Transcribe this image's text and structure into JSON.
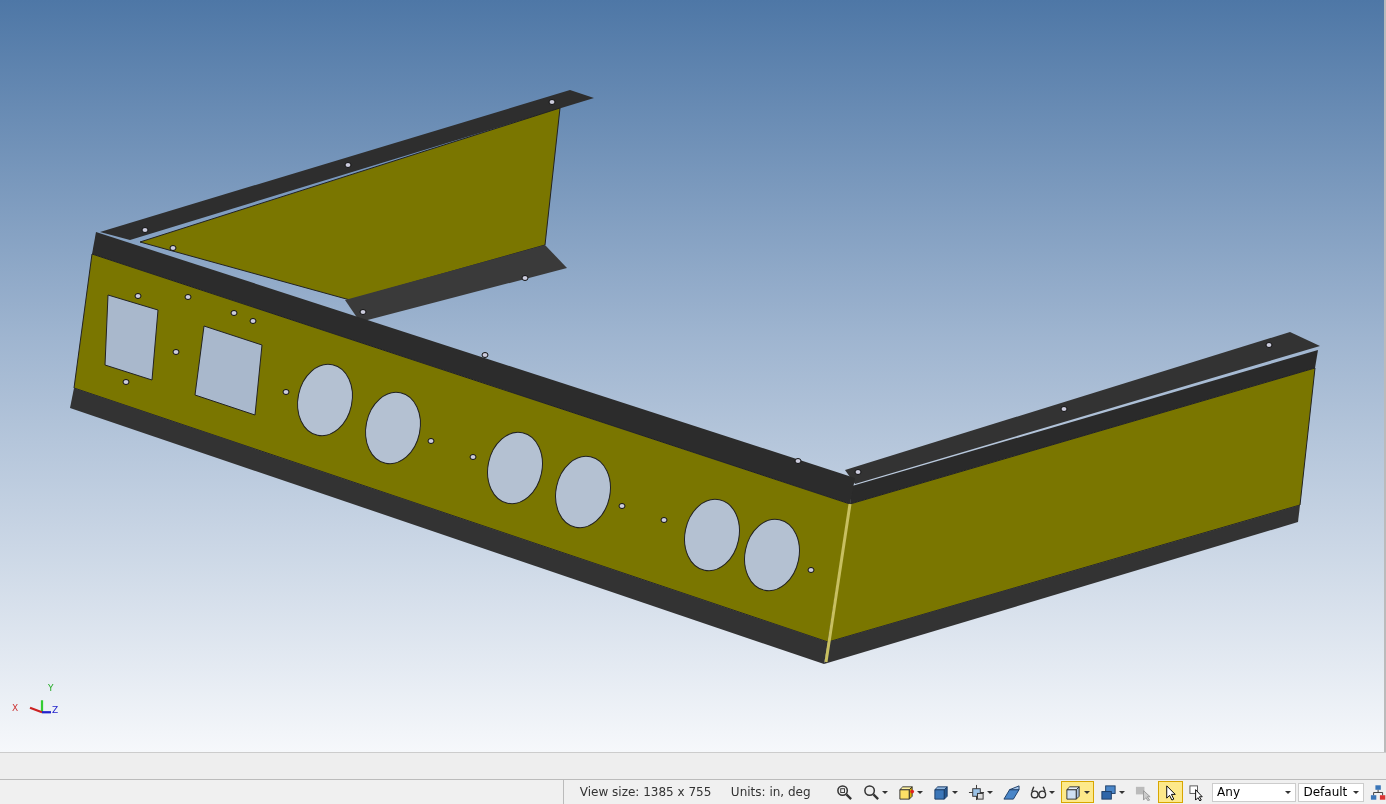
{
  "viewport": {
    "triad": {
      "x_label": "X",
      "y_label": "Y",
      "z_label": "Z"
    }
  },
  "status_bar": {
    "view_size": "View size: 1385 x  755",
    "units": "Units: in, deg",
    "tools": [
      {
        "kind": "zoom-fit",
        "selected": false,
        "dropdown": false
      },
      {
        "kind": "zoom",
        "selected": false,
        "dropdown": true
      },
      {
        "kind": "box-star",
        "selected": false,
        "dropdown": true
      },
      {
        "kind": "cube",
        "selected": false,
        "dropdown": true
      },
      {
        "kind": "layers",
        "selected": false,
        "dropdown": true
      },
      {
        "kind": "wedge",
        "selected": false,
        "dropdown": false
      },
      {
        "kind": "glasses",
        "selected": false,
        "dropdown": true
      },
      {
        "kind": "wire-cube",
        "selected": true,
        "dropdown": true
      },
      {
        "kind": "stack",
        "selected": false,
        "dropdown": true
      },
      {
        "kind": "pointer-grey",
        "selected": false,
        "dropdown": false
      },
      {
        "kind": "pointer",
        "selected": true,
        "dropdown": false
      },
      {
        "kind": "pointer-box",
        "selected": false,
        "dropdown": false
      }
    ],
    "filter": {
      "value": "Any"
    },
    "style": {
      "value": "Default"
    }
  }
}
